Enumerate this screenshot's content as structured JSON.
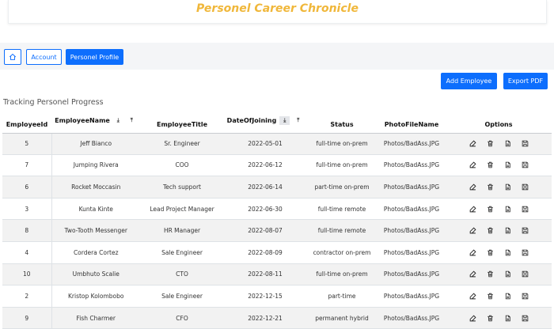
{
  "banner": {
    "title": "Personel Career Chronicle"
  },
  "nav": {
    "account_label": "Account",
    "profile_label": "Personel Profile"
  },
  "toolbar": {
    "add_label": "Add Employee",
    "export_label": "Export PDF"
  },
  "caption": "Tracking Personel Progress",
  "table": {
    "headers": {
      "id": "EmployeeId",
      "name": "EmployeeName",
      "title": "EmployeeTitle",
      "date": "DateOfJoining",
      "status": "Status",
      "photo": "PhotoFileName",
      "options": "Options"
    },
    "rows": [
      {
        "id": "5",
        "name": "Jeff Bianco",
        "title": "Sr. Engineer",
        "date": "2022-05-01",
        "status": "full-time on-prem",
        "photo": "Photos/BadAss.JPG"
      },
      {
        "id": "7",
        "name": "Jumping Rivera",
        "title": "COO",
        "date": "2022-06-12",
        "status": "full-time on-prem",
        "photo": "Photos/BadAss.JPG"
      },
      {
        "id": "6",
        "name": "Rocket Moccasin",
        "title": "Tech support",
        "date": "2022-06-14",
        "status": "part-time on-prem",
        "photo": "Photos/BadAss.JPG"
      },
      {
        "id": "3",
        "name": "Kunta Kinte",
        "title": "Lead Project Manager",
        "date": "2022-06-30",
        "status": "full-time remote",
        "photo": "Photos/BadAss.JPG"
      },
      {
        "id": "8",
        "name": "Two-Tooth Messenger",
        "title": "HR Manager",
        "date": "2022-08-07",
        "status": "full-time remote",
        "photo": "Photos/BadAss.JPG"
      },
      {
        "id": "4",
        "name": "Cordera Cortez",
        "title": "Sale Engineer",
        "date": "2022-08-09",
        "status": "contractor on-prem",
        "photo": "Photos/BadAss.JPG"
      },
      {
        "id": "10",
        "name": "Umbhuto Scalie",
        "title": "CTO",
        "date": "2022-08-11",
        "status": "full-time on-prem",
        "photo": "Photos/BadAss.JPG"
      },
      {
        "id": "2",
        "name": "Kristop Kolombobo",
        "title": "Sale Engineer",
        "date": "2022-12-15",
        "status": "part-time",
        "photo": "Photos/BadAss.JPG"
      },
      {
        "id": "9",
        "name": "Fish Charmer",
        "title": "CFO",
        "date": "2022-12-21",
        "status": "permanent hybrid",
        "photo": "Photos/BadAss.JPG"
      }
    ]
  },
  "icons": {
    "home": "home-icon",
    "sort_asc": "sort-ascending-icon",
    "sort_desc": "sort-descending-icon",
    "edit": "edit-icon",
    "delete": "trash-icon",
    "view": "document-icon",
    "save": "save-icon"
  },
  "colors": {
    "primary": "#0d6efd",
    "banner_title": "#f0b73a",
    "stripe": "#f2f2f2"
  }
}
